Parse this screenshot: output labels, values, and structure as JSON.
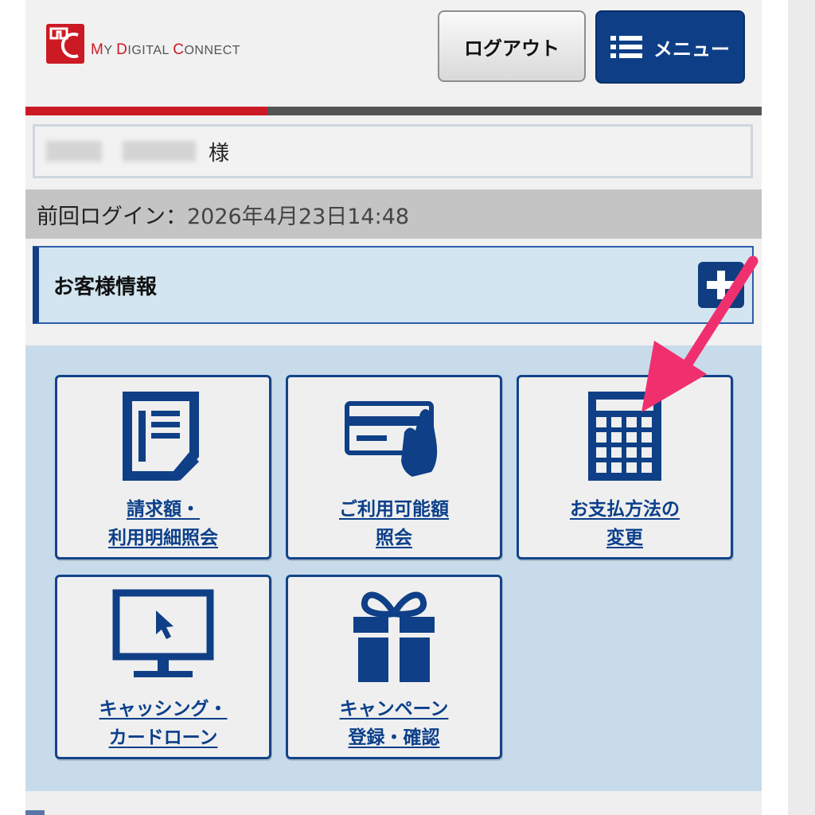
{
  "header": {
    "logo_initial_m": "M",
    "logo_rest_my": "Y ",
    "logo_initial_d": "D",
    "logo_rest_digital": "IGITAL ",
    "logo_initial_c": "C",
    "logo_rest_connect": "ONNECT",
    "logout_label": "ログアウト",
    "menu_label": "メニュー"
  },
  "user": {
    "honorific": "様"
  },
  "last_login": {
    "label": "前回ログイン：",
    "value": "2026年4月23日14:48"
  },
  "customer_panel": {
    "title": "お客様情報"
  },
  "tiles": [
    {
      "line1": "請求額・",
      "line2": "利用明細照会",
      "icon": "document-icon"
    },
    {
      "line1": "ご利用可能額",
      "line2": "照会",
      "icon": "card-hand-icon"
    },
    {
      "line1": "お支払方法の",
      "line2": "変更",
      "icon": "calculator-icon"
    },
    {
      "line1": "キャッシング・",
      "line2": "カードローン",
      "icon": "monitor-cursor-icon"
    },
    {
      "line1": "キャンペーン",
      "line2": "登録・確認",
      "icon": "gift-icon"
    }
  ],
  "colors": {
    "brand_red": "#cc1a24",
    "navy": "#0e3f86",
    "annotation_pink": "#f0306e"
  }
}
